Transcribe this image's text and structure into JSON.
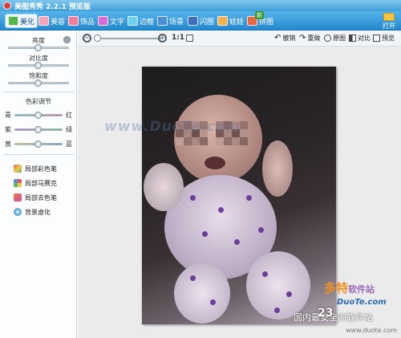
{
  "window": {
    "title": "美图秀秀 2.2.1 预览版"
  },
  "toolbar": {
    "tabs": [
      {
        "label": "美化",
        "icon": "beautify-icon"
      },
      {
        "label": "美容",
        "icon": "face-icon"
      },
      {
        "label": "饰品",
        "icon": "heart-icon"
      },
      {
        "label": "文字",
        "icon": "text-icon"
      },
      {
        "label": "边框",
        "icon": "frame-icon"
      },
      {
        "label": "场景",
        "icon": "scene-icon"
      },
      {
        "label": "闪图",
        "icon": "flash-icon"
      },
      {
        "label": "娃娃",
        "icon": "doll-icon"
      },
      {
        "label": "拼图",
        "icon": "puzzle-icon"
      }
    ],
    "new_badge": "新",
    "open_label": "打开"
  },
  "sidebar": {
    "brightness": "亮度",
    "contrast": "对比度",
    "saturation": "饱和度",
    "color_title": "色彩调节",
    "color_rows": [
      {
        "left": "青",
        "right": "红"
      },
      {
        "left": "紫",
        "right": "绿"
      },
      {
        "left": "黄",
        "right": "蓝"
      }
    ],
    "tools": [
      {
        "label": "局部彩色笔",
        "icon": "brush-icon"
      },
      {
        "label": "局部马赛克",
        "icon": "mosaic-icon"
      },
      {
        "label": "局部去色笔",
        "icon": "decolor-icon"
      },
      {
        "label": "背景虚化",
        "icon": "blur-icon"
      }
    ]
  },
  "viewbar": {
    "zoom_out": "−",
    "zoom_in": "+",
    "ratio": "1:1",
    "undo": "撤销",
    "redo": "重做",
    "original": "原图",
    "compare": "对比",
    "preview": "预览"
  },
  "watermarks": {
    "center": "www.DuoTe.com",
    "logo_a": "多特",
    "logo_b": "软件站",
    "url": "DuoTe.com",
    "num": "23",
    "sub": "国内最安全的软件站",
    "url2": "www.duote.com"
  }
}
